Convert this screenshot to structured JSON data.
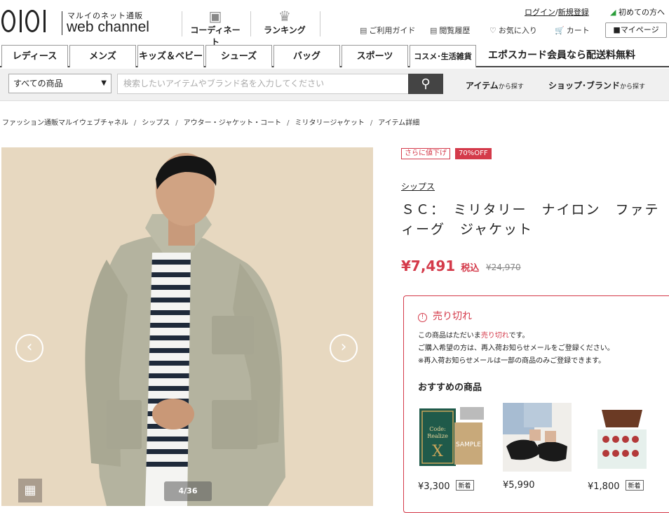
{
  "header": {
    "logo_sub": "マルイのネット通販",
    "logo_main": "web channel",
    "nav": [
      {
        "label": "コーディネート",
        "icon": "camera-icon"
      },
      {
        "label": "ランキング",
        "icon": "crown-icon"
      }
    ],
    "login": "ログイン",
    "slash": "/",
    "register": "新規登録",
    "beginner": "初めての方へ",
    "utilities": [
      {
        "label": "ご利用ガイド",
        "icon": "book-icon"
      },
      {
        "label": "閲覧履歴",
        "icon": "history-icon"
      },
      {
        "label": "お気に入り",
        "icon": "heart-icon"
      },
      {
        "label": "カート",
        "icon": "cart-icon"
      }
    ],
    "mypage": "マイページ"
  },
  "categories": [
    "レディース",
    "メンズ",
    "キッズ＆ベビー",
    "シューズ",
    "バッグ",
    "スポーツ",
    "コスメ･生活雑貨"
  ],
  "promo": "エポスカード会員なら配送料無料",
  "search": {
    "category_selected": "すべての商品",
    "placeholder": "検索したいアイテムやブランド名を入力してください",
    "find_item": "アイテム",
    "find_item_suffix": "から探す",
    "find_shop": "ショップ･ブランド",
    "find_shop_suffix": "から探す"
  },
  "breadcrumb": [
    "ファッション通販マルイウェブチャネル",
    "シップス",
    "アウター・ジャケット・コート",
    "ミリタリージャケット",
    "アイテム詳細"
  ],
  "gallery": {
    "counter": "4/36"
  },
  "product": {
    "badge_sale": "さらに値下げ",
    "badge_off": "70%OFF",
    "brand": "シップス",
    "title": "ＳＣ：　ミリタリー　ナイロン　ファティーグ　ジャケット",
    "price": "¥7,491",
    "tax": "税込",
    "old_price": "¥24,970"
  },
  "soldout": {
    "heading": "売り切れ",
    "line1_a": "この商品はただいま",
    "line1_red": "売り切れ",
    "line1_b": "です。",
    "line2": "ご購入希望の方は、再入荷お知らせメールをご登録ください。",
    "line3": "※再入荷お知らせメールは一部の商品のみご登録できます。"
  },
  "recommend": {
    "heading": "おすすめの商品",
    "items": [
      {
        "price": "¥3,300",
        "tag": "新着"
      },
      {
        "price": "¥5,990",
        "tag": ""
      },
      {
        "price": "¥1,800",
        "tag": "新着"
      }
    ]
  },
  "colors": {
    "accent": "#d43a4a",
    "dark": "#444444"
  }
}
